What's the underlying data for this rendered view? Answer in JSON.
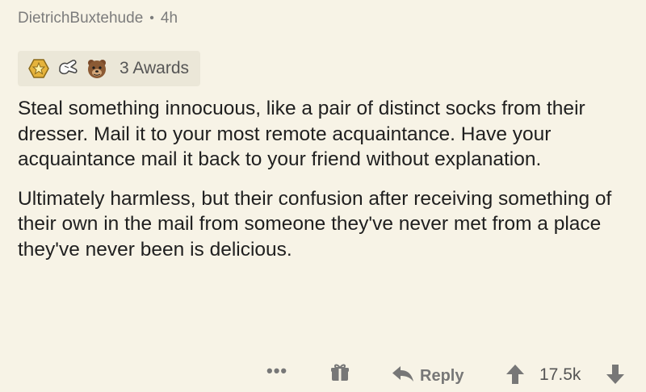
{
  "comment": {
    "author": "DietrichBuxtehude",
    "separator": "•",
    "age": "4h",
    "awards": {
      "icons": [
        "gold-star-award-icon",
        "helping-hand-award-icon",
        "bear-award-icon"
      ],
      "label": "3 Awards"
    },
    "paragraphs": [
      "Steal something innocuous, like a pair of distinct socks from their dresser. Mail it to your most remote acquaintance. Have your acquaintance mail it back to your friend without explanation.",
      "Ultimately harmless, but their confusion after receiving something of their own in the mail from someone they've never met from a place they've never been is delicious."
    ],
    "actions": {
      "more_label": "•••",
      "reply_label": "Reply",
      "score": "17.5k"
    }
  },
  "colors": {
    "background": "#f7f3e6",
    "awards_bg": "#ebe7d8",
    "meta_text": "#7c7c7c",
    "action_icon": "#777777"
  }
}
